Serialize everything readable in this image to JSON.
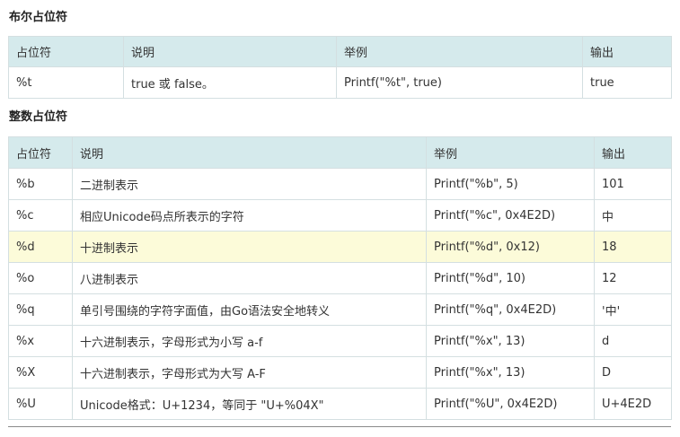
{
  "bool_section": {
    "title": "布尔占位符",
    "headers": [
      "占位符",
      "说明",
      "举例",
      "输出"
    ],
    "rows": [
      [
        "%t",
        "true 或 false。",
        "Printf(\"%t\", true)",
        "true"
      ]
    ]
  },
  "int_section": {
    "title": "整数占位符",
    "headers": [
      "占位符",
      "说明",
      "举例",
      "输出"
    ],
    "highlighted_row": 2,
    "rows": [
      [
        "%b",
        "二进制表示",
        "Printf(\"%b\", 5)",
        "101"
      ],
      [
        "%c",
        "相应Unicode码点所表示的字符",
        "Printf(\"%c\", 0x4E2D)",
        "中"
      ],
      [
        "%d",
        "十进制表示",
        "Printf(\"%d\", 0x12)",
        "18"
      ],
      [
        "%o",
        "八进制表示",
        "Printf(\"%d\", 10)",
        "12"
      ],
      [
        "%q",
        "单引号围绕的字符字面值，由Go语法安全地转义",
        "Printf(\"%q\", 0x4E2D)",
        "'中'"
      ],
      [
        "%x",
        "十六进制表示，字母形式为小写 a-f",
        "Printf(\"%x\", 13)",
        "d"
      ],
      [
        "%X",
        "十六进制表示，字母形式为大写 A-F",
        "Printf(\"%x\", 13)",
        "D"
      ],
      [
        "%U",
        "Unicode格式：U+1234，等同于 \"U+%04X\"",
        "Printf(\"%U\", 0x4E2D)",
        "U+4E2D"
      ]
    ]
  },
  "colors": {
    "header_bg": "#d5eaec",
    "border": "#d4dfe1",
    "highlight_bg": "#fcfbd9"
  }
}
